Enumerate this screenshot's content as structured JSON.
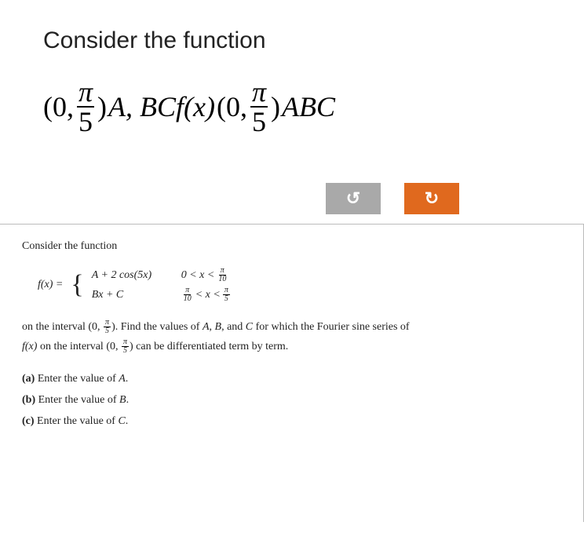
{
  "top": {
    "title": "Consider the function",
    "math": {
      "open1": "(0,",
      "frac_num": "π",
      "frac_den": "5",
      "close1": ")",
      "mid1": "A, BCf(x)",
      "open2": "(0,",
      "close2": ")",
      "mid2": "ABC"
    }
  },
  "buttons": {
    "undo": "↺",
    "redo": "↻"
  },
  "panel": {
    "title": "Consider the function",
    "fx_label": "f(x) =",
    "cases": [
      {
        "left": "A + 2 cos(5x)",
        "cond_pre": "0 < x <",
        "cond_frac": {
          "n": "π",
          "d": "10"
        }
      },
      {
        "left": "Bx + C",
        "cond_pre_frac": {
          "n": "π",
          "d": "10"
        },
        "cond_mid": "< x <",
        "cond_frac": {
          "n": "π",
          "d": "5"
        }
      }
    ],
    "body_pre": "on the interval ",
    "interval_open": "(0, ",
    "interval_frac": {
      "n": "π",
      "d": "5"
    },
    "interval_close": ")",
    "body_mid": ". Find the values of ",
    "A": "A",
    "B": "B",
    "C": "C",
    "body_mid2": ", and ",
    "body_mid3": " for which the Fourier sine series of",
    "body_line2_pre": "f(x) on the interval ",
    "body_line2_post": " can be differentiated term by term.",
    "parts": [
      {
        "label": "(a)",
        "text_pre": "Enter the value of ",
        "var": "A",
        "text_post": "."
      },
      {
        "label": "(b)",
        "text_pre": "Enter the value of ",
        "var": "B",
        "text_post": "."
      },
      {
        "label": "(c)",
        "text_pre": "Enter the value of ",
        "var": "C",
        "text_post": "."
      }
    ]
  }
}
